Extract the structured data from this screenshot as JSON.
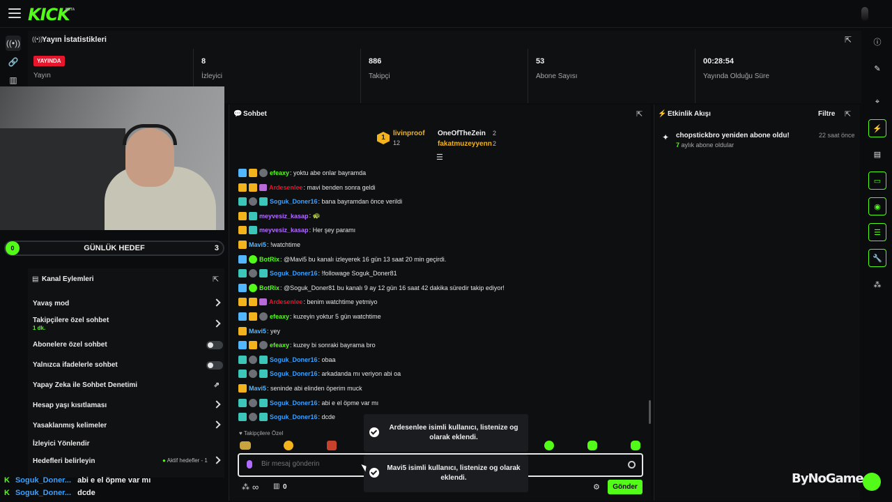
{
  "brand": {
    "logo": "KICK",
    "beta": "BETA",
    "accent": "#53fc18"
  },
  "stats": {
    "title": "Yayın İstatistikleri",
    "live_badge": "YAYINDA",
    "stream_label": "Yayın",
    "viewers_value": "8",
    "viewers_label": "İzleyici",
    "followers_value": "886",
    "followers_label": "Takipçi",
    "subs_value": "53",
    "subs_label": "Abone Sayısı",
    "uptime_value": "00:28:54",
    "uptime_label": "Yayında Olduğu Süre"
  },
  "goal": {
    "current": "0",
    "label": "GÜNLÜK HEDEF",
    "target": "3"
  },
  "actions": {
    "title": "Kanal Eylemleri",
    "items": [
      {
        "label": "Yavaş mod"
      },
      {
        "label": "Takipçilere özel sohbet",
        "sub": "1 dk."
      },
      {
        "label": "Abonelere özel sohbet"
      },
      {
        "label": "Yalnızca ifadelerle sohbet"
      },
      {
        "label": "Yapay Zeka ile Sohbet Denetimi"
      },
      {
        "label": "Hesap yaşı kısıtlaması"
      },
      {
        "label": "Yasaklanmış kelimeler"
      },
      {
        "label": "İzleyici Yönlendir"
      },
      {
        "label": "Hedefleri belirleyin",
        "extra": "Aktif hedefler - 1"
      }
    ]
  },
  "overlay_chat": [
    {
      "user": "Soguk_Doner...",
      "text": "abi e el öpme var mı"
    },
    {
      "user": "Soguk_Doner...",
      "text": "dcde"
    }
  ],
  "chat": {
    "title": "Sohbet",
    "top_gifters": [
      {
        "name": "livinproof",
        "count": "12",
        "rank": "1"
      },
      {
        "name": "OneOfTheZein",
        "count": "2"
      },
      {
        "name": "fakatmuzeyyenn",
        "count": "2"
      }
    ],
    "messages": [
      {
        "user": "efeaxy",
        "color": "#53fc18",
        "text": ": yoktu abe onlar bayramda",
        "badges": [
          "sub",
          "vip",
          "round"
        ]
      },
      {
        "user": "Ardesenlee",
        "color": "#e6162d",
        "text": ": mavi benden sonra geldi",
        "badges": [
          "vip",
          "vip",
          "gift"
        ]
      },
      {
        "user": "Soguk_Doner16",
        "color": "#3aa0ff",
        "text": ": bana bayramdan önce verildi",
        "badges": [
          "mod",
          "round",
          "mod"
        ]
      },
      {
        "user": "meyvesiz_kasap",
        "color": "#b16cff",
        "text": ": 🐢",
        "badges": [
          "vip",
          "mod"
        ]
      },
      {
        "user": "meyvesiz_kasap",
        "color": "#b16cff",
        "text": ": Her şey paramı",
        "badges": [
          "vip",
          "mod"
        ]
      },
      {
        "user": "Mavi5",
        "color": "#53b7ff",
        "text": ": !watchtime",
        "badges": [
          "vip"
        ]
      },
      {
        "user": "BotRix",
        "color": "#53fc18",
        "text": ": @Mavi5 bu kanalı izleyerek 16 gün 13 saat 20 min geçirdi.",
        "badges": [
          "sub",
          "ver"
        ]
      },
      {
        "user": "Soguk_Doner16",
        "color": "#3aa0ff",
        "text": ": !followage Soguk_Doner81",
        "badges": [
          "mod",
          "round",
          "mod"
        ]
      },
      {
        "user": "BotRix",
        "color": "#53fc18",
        "text": ": @Soguk_Doner81 bu kanalı 9 ay 12 gün 16 saat 42 dakika süredir takip ediyor!",
        "badges": [
          "sub",
          "ver"
        ]
      },
      {
        "user": "Ardesenlee",
        "color": "#e6162d",
        "text": ": benim watchtime yetmiyo",
        "badges": [
          "vip",
          "vip",
          "gift"
        ]
      },
      {
        "user": "efeaxy",
        "color": "#53fc18",
        "text": ": kuzeyin yoktur 5 gün watchtime",
        "badges": [
          "sub",
          "vip",
          "round"
        ]
      },
      {
        "user": "Mavi5",
        "color": "#53b7ff",
        "text": ": yey",
        "badges": [
          "vip"
        ]
      },
      {
        "user": "efeaxy",
        "color": "#53fc18",
        "text": ": kuzey bi sonraki bayrama bro",
        "badges": [
          "sub",
          "vip",
          "round"
        ]
      },
      {
        "user": "Soguk_Doner16",
        "color": "#3aa0ff",
        "text": ": obaa",
        "badges": [
          "mod",
          "round",
          "mod"
        ]
      },
      {
        "user": "Soguk_Doner16",
        "color": "#3aa0ff",
        "text": ": arkadanda mı veriyon abi oa",
        "badges": [
          "mod",
          "round",
          "mod"
        ]
      },
      {
        "user": "Mavi5",
        "color": "#53b7ff",
        "text": ": seninde abi elinden öperim muck",
        "badges": [
          "vip"
        ]
      },
      {
        "user": "Soguk_Doner16",
        "color": "#3aa0ff",
        "text": ": abi e el öpme var mı",
        "badges": [
          "mod",
          "round",
          "mod"
        ]
      },
      {
        "user": "Soguk_Doner16",
        "color": "#3aa0ff",
        "text": ": dcde",
        "badges": [
          "mod",
          "round",
          "mod"
        ]
      }
    ],
    "followers_only_label": "Takipçilere Özel",
    "input_placeholder": "Bir mesaj gönderin",
    "send_label": "Gönder",
    "infinity": "∞",
    "points": "0"
  },
  "toasts": [
    "Ardesenlee isimli kullanıcı, listenize og olarak eklendi.",
    "Mavi5 isimli kullanıcı, listenize og olarak eklendi."
  ],
  "feed": {
    "title": "Etkinlik Akışı",
    "filter_label": "Filtre",
    "events": [
      {
        "title": "chopstickbro yeniden abone oldu!",
        "time": "22 saat önce",
        "months": "7",
        "detail": " aylık abone oldular"
      }
    ]
  },
  "watermark": "ByNoGame"
}
